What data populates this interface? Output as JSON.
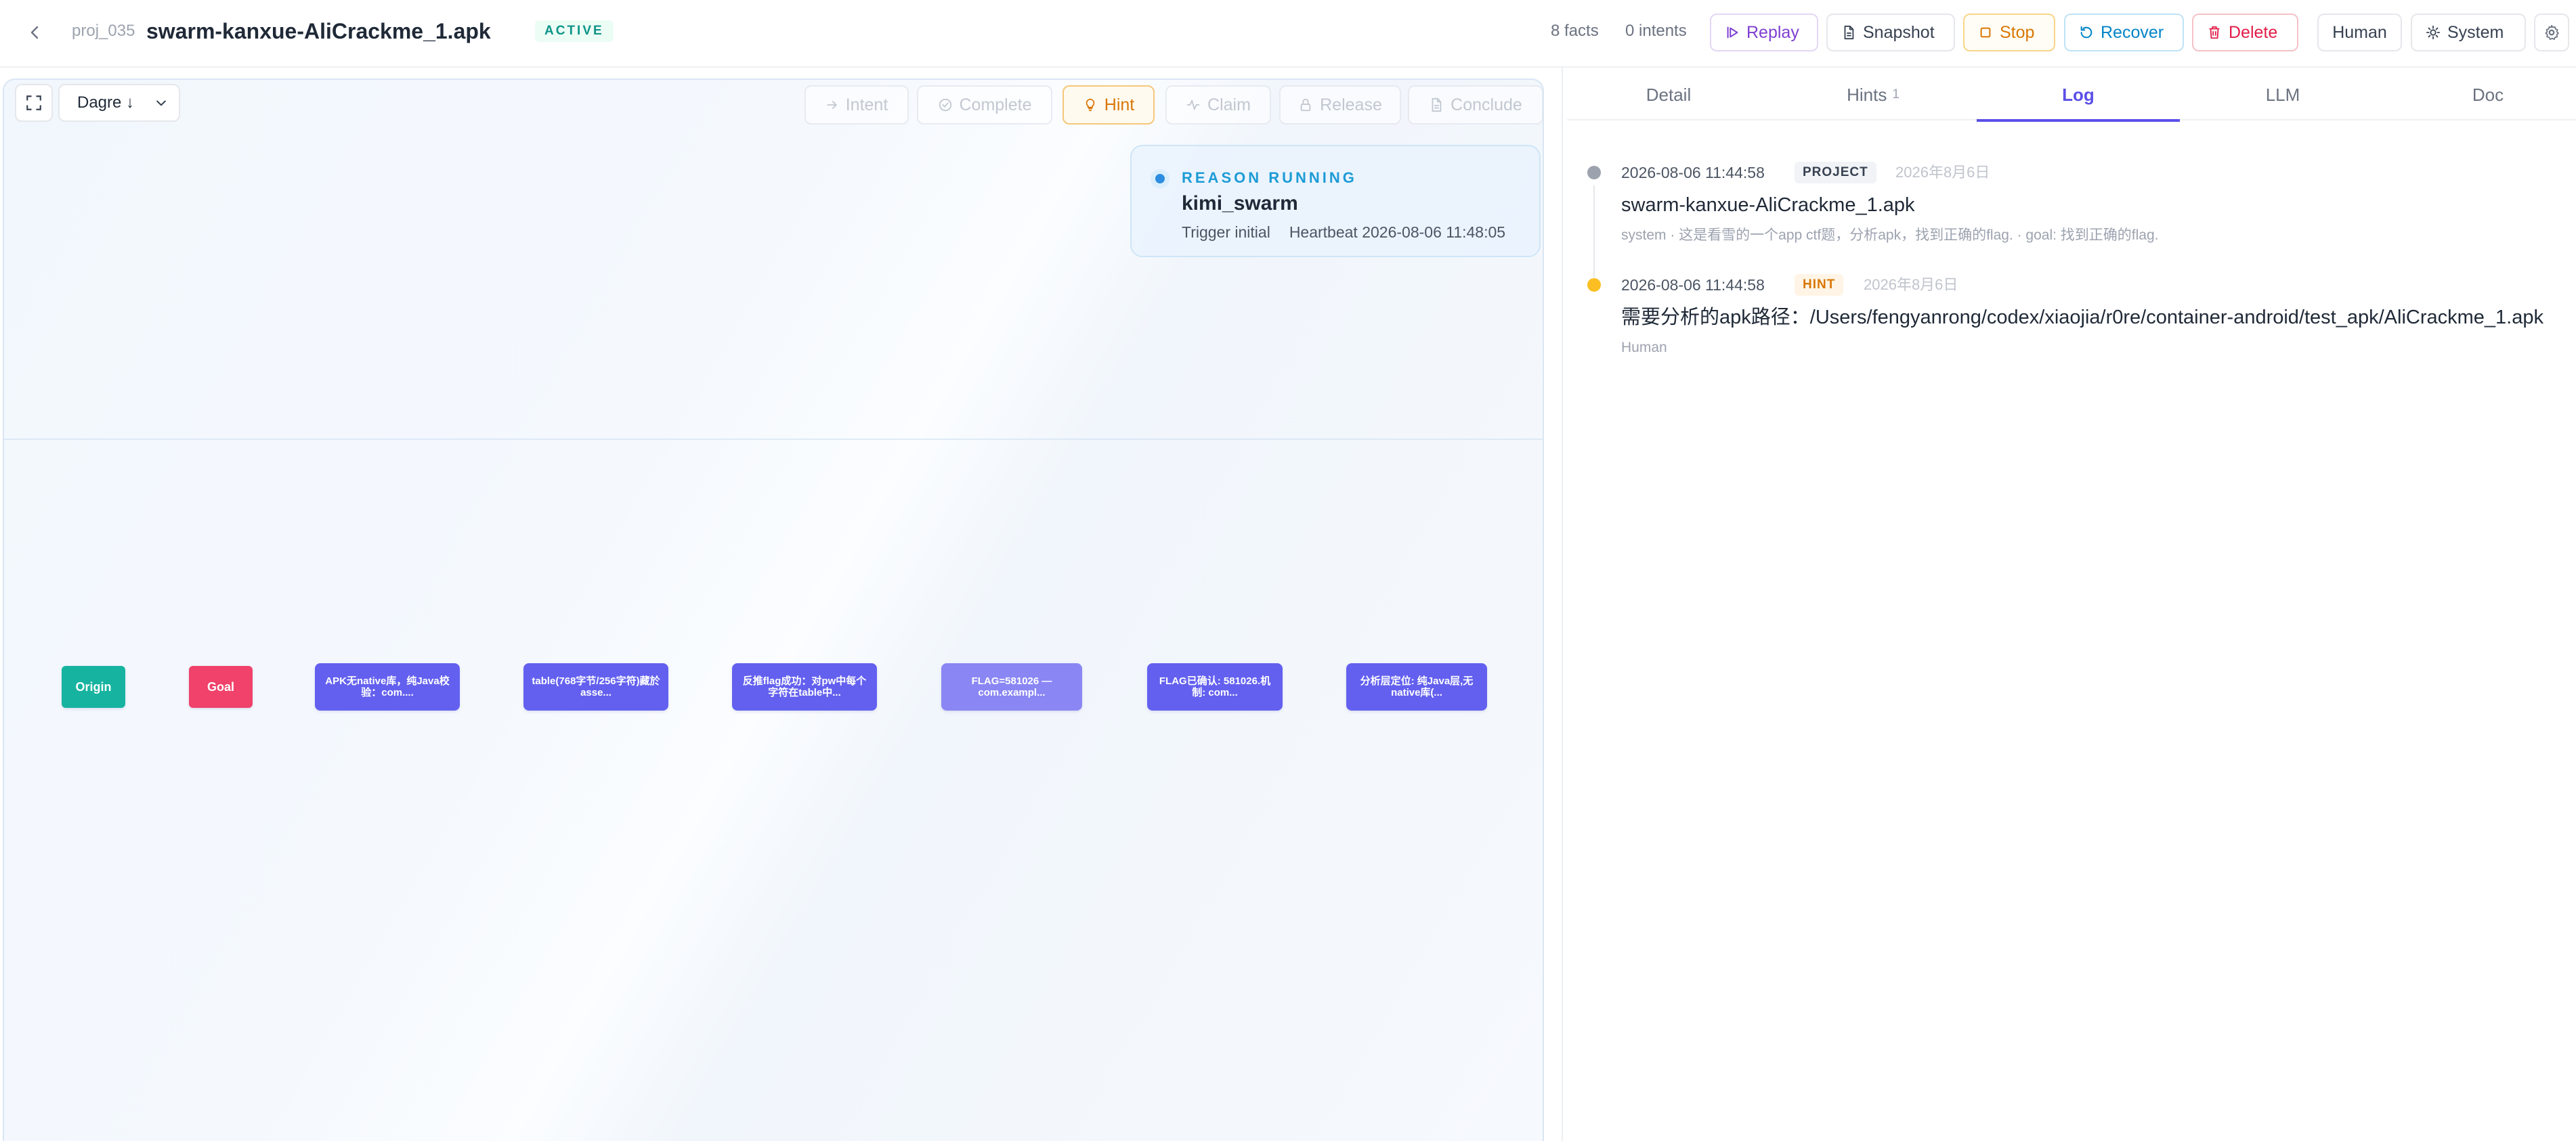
{
  "header": {
    "project_id": "proj_035",
    "project_title": "swarm-kanxue-AliCrackme_1.apk",
    "status": "ACTIVE",
    "facts_count": "8 facts",
    "intents_count": "0 intents",
    "buttons": {
      "replay": "Replay",
      "snapshot": "Snapshot",
      "stop": "Stop",
      "recover": "Recover",
      "delete": "Delete",
      "human": "Human",
      "system": "System"
    }
  },
  "graph": {
    "layout_value": "Dagre ↓",
    "actions": {
      "intent": "Intent",
      "complete": "Complete",
      "hint": "Hint",
      "claim": "Claim",
      "release": "Release",
      "conclude": "Conclude"
    },
    "reason": {
      "label": "REASON RUNNING",
      "agent": "kimi_swarm",
      "trigger": "Trigger initial",
      "heartbeat": "Heartbeat 2026-08-06 11:48:05"
    },
    "nodes": [
      {
        "label": "Origin",
        "kind": "origin"
      },
      {
        "label": "Goal",
        "kind": "goal"
      },
      {
        "label": "APK无native库，纯Java校验：com....",
        "kind": "fact"
      },
      {
        "label": "table(768字节/256字符)藏於asse...",
        "kind": "fact"
      },
      {
        "label": "反推flag成功：对pw中每个字符在table中...",
        "kind": "fact"
      },
      {
        "label": "FLAG=581026 — com.exampl...",
        "kind": "fact"
      },
      {
        "label": "FLAG已确认: 581026.机制: com...",
        "kind": "fact"
      },
      {
        "label": "分析层定位: 纯Java层,无native库(...",
        "kind": "fact"
      }
    ]
  },
  "panel": {
    "tabs": [
      {
        "label": "Detail",
        "count": ""
      },
      {
        "label": "Hints",
        "count": "1"
      },
      {
        "label": "Log",
        "count": ""
      },
      {
        "label": "LLM",
        "count": ""
      },
      {
        "label": "Doc",
        "count": ""
      }
    ],
    "active_tab": "Log",
    "log": [
      {
        "time": "2026-08-06 11:44:58",
        "type": "PROJECT",
        "date": "2026年8月6日",
        "title": "swarm-kanxue-AliCrackme_1.apk",
        "sub": "system · 这是看雪的一个app ctf题，分析apk，找到正确的flag. · goal: 找到正确的flag."
      },
      {
        "time": "2026-08-06 11:44:58",
        "type": "HINT",
        "date": "2026年8月6日",
        "title": "需要分析的apk路径：/Users/fengyanrong/codex/xiaojia/r0re/container-android/test_apk/AliCrackme_1.apk",
        "sub": "Human"
      }
    ]
  },
  "colors": {
    "accent": "#5b4fe8",
    "origin": "#16b3a0",
    "goal": "#f0426a",
    "fact": "#6360ef",
    "active_badge": "#0d9488",
    "hint_badge": "#d97706"
  },
  "icons": [
    "chevron-left-icon",
    "play-icon",
    "snapshot-icon",
    "stop-icon",
    "recover-icon",
    "trash-icon",
    "sun-icon",
    "gear-icon",
    "fit-view-icon",
    "chevron-down-icon",
    "arrow-right-icon",
    "check-circle-icon",
    "lightbulb-icon",
    "pulse-icon",
    "lock-icon",
    "document-icon"
  ]
}
